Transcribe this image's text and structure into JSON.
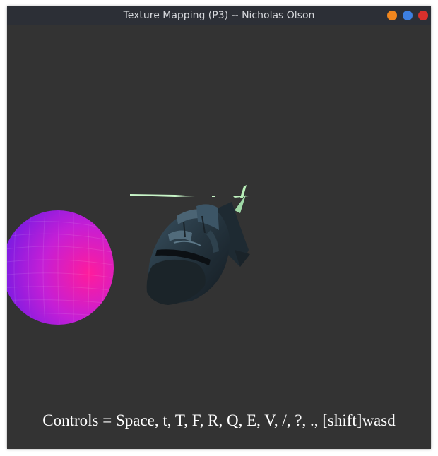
{
  "window": {
    "title": "Texture Mapping (P3) -- Nicholas Olson",
    "buttons": [
      {
        "name": "minimize",
        "color": "#f0861e"
      },
      {
        "name": "maximize",
        "color": "#3d7fe0"
      },
      {
        "name": "close",
        "color": "#d9302c"
      }
    ]
  },
  "scene": {
    "background": "#333333",
    "objects": [
      "textured-sphere",
      "helicopter-model"
    ]
  },
  "overlay": {
    "controls_text": "Controls = Space, t, T, F, R, Q, E, V, /, ?, ., [shift]wasd"
  }
}
